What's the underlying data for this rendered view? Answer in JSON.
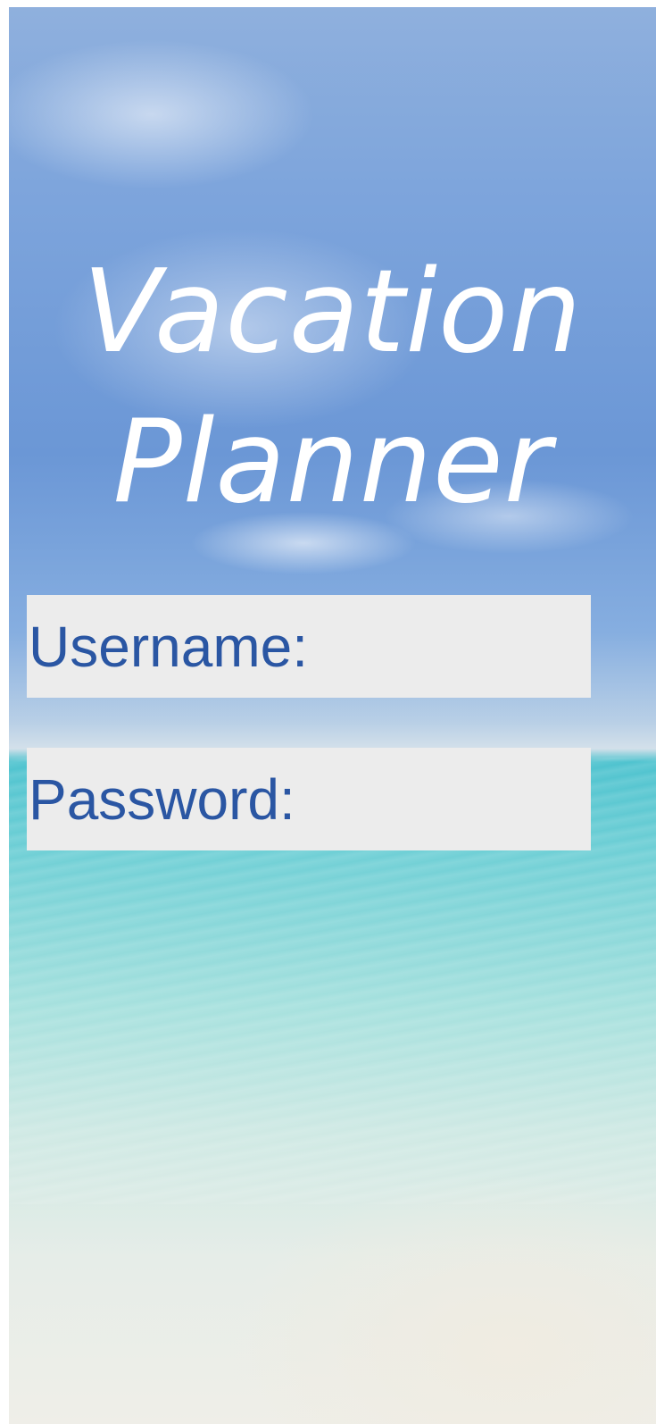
{
  "app": {
    "title_line1": "Vacation",
    "title_line2": "Planner"
  },
  "login_form": {
    "username_label": "Username:",
    "username_value": "",
    "password_label": "Password:",
    "password_value": ""
  },
  "colors": {
    "title_text": "#ffffff",
    "label_text": "#2a56a3",
    "field_background": "#ececec"
  },
  "background": {
    "image": "beach-sky-photo"
  }
}
